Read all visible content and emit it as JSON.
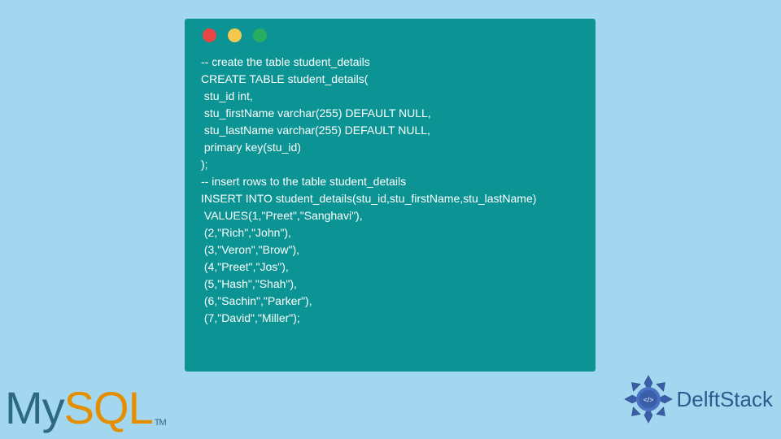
{
  "code": {
    "lines": [
      "-- create the table student_details",
      "CREATE TABLE student_details(",
      " stu_id int,",
      " stu_firstName varchar(255) DEFAULT NULL,",
      " stu_lastName varchar(255) DEFAULT NULL,",
      " primary key(stu_id)",
      ");",
      "-- insert rows to the table student_details",
      "INSERT INTO student_details(stu_id,stu_firstName,stu_lastName)",
      " VALUES(1,\"Preet\",\"Sanghavi\"),",
      " (2,\"Rich\",\"John\"),",
      " (3,\"Veron\",\"Brow\"),",
      " (4,\"Preet\",\"Jos\"),",
      " (5,\"Hash\",\"Shah\"),",
      " (6,\"Sachin\",\"Parker\"),",
      " (7,\"David\",\"Miller\");"
    ]
  },
  "logos": {
    "mysql_my": "My",
    "mysql_sql": "SQL",
    "mysql_tm": "TM",
    "delft": "DelftStack"
  }
}
